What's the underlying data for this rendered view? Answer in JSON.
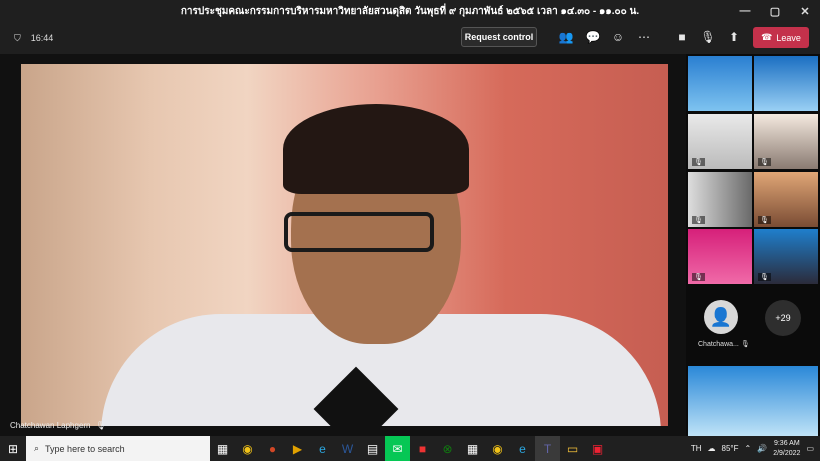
{
  "window": {
    "title": "การประชุมคณะกรรมการบริหารมหาวิทยาลัยสวนดุสิต วันพุธที่ ๙ กุมภาพันธ์ ๒๕๖๕ เวลา ๑๔.๓๐ - ๑๑.๐๐ น.",
    "controls": [
      "—",
      "▢",
      "✕"
    ]
  },
  "toolbar": {
    "timer": "16:44",
    "request_control": "Request control",
    "leave": "Leave"
  },
  "main_video": {
    "participant_name": "Chatchawan Laphgern"
  },
  "sidebar": {
    "avatar_name": "Chatchawa...",
    "overflow_count": "+29"
  },
  "taskbar": {
    "search_placeholder": "Type here to search",
    "language": "TH",
    "temperature": "85°F",
    "time": "9:36 AM",
    "date": "2/9/2022"
  },
  "colors": {
    "leave": "#c4314b",
    "toolbar": "#1f1f1f",
    "stage": "#111111"
  }
}
